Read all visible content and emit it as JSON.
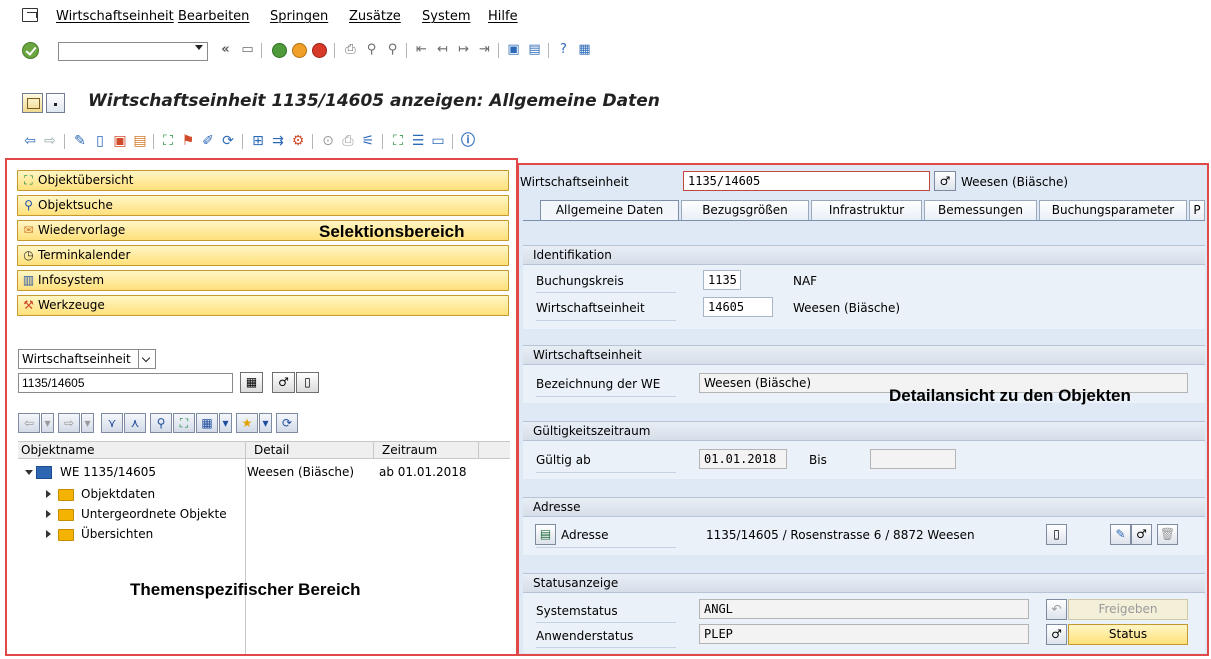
{
  "menu": {
    "items": [
      "Wirtschaftseinheit",
      "Bearbeiten",
      "Springen",
      "Zusätze",
      "System",
      "Hilfe"
    ]
  },
  "standard_toolbar": {
    "command_field_value": "",
    "back_glyph": "«"
  },
  "title": "Wirtschaftseinheit 1135/14605 anzeigen: Allgemeine Daten",
  "left_panel": {
    "nav_buttons": [
      {
        "label": "Objektübersicht",
        "icon": "hierarchy-icon"
      },
      {
        "label": "Objektsuche",
        "icon": "binoculars-icon"
      },
      {
        "label": "Wiedervorlage",
        "icon": "resubmission-icon"
      },
      {
        "label": "Terminkalender",
        "icon": "clock-icon"
      },
      {
        "label": "Infosystem",
        "icon": "infosystem-icon"
      },
      {
        "label": "Werkzeuge",
        "icon": "tools-icon"
      }
    ],
    "selection_area_label": "Selektionsbereich",
    "object_type": "Wirtschaftseinheit",
    "object_input": "1135/14605",
    "tree": {
      "columns": [
        "Objektname",
        "Detail",
        "Zeitraum"
      ],
      "root": {
        "name": "WE 1135/14605",
        "detail": "Weesen (Biäsche)",
        "period": "ab 01.01.2018"
      },
      "children": [
        "Objektdaten",
        "Untergeordnete Objekte",
        "Übersichten"
      ]
    },
    "theme_area_label": "Themenspezifischer Bereich"
  },
  "right_panel": {
    "header": {
      "label": "Wirtschaftseinheit",
      "value": "1135/14605",
      "description": "Weesen (Biäsche)"
    },
    "tabs": [
      "Allgemeine Daten",
      "Bezugsgrößen",
      "Infrastruktur",
      "Bemessungen",
      "Buchungsparameter",
      "P"
    ],
    "groups": {
      "identifikation": {
        "title": "Identifikation",
        "buchungskreis_label": "Buchungskreis",
        "buchungskreis_value": "1135",
        "buchungskreis_text": "NAF",
        "we_label": "Wirtschaftseinheit",
        "we_value": "14605",
        "we_text": "Weesen (Biäsche)"
      },
      "wirtschaftseinheit": {
        "title": "Wirtschaftseinheit",
        "bez_label": "Bezeichnung der WE",
        "bez_value": "Weesen (Biäsche)"
      },
      "gueltigkeit": {
        "title": "Gültigkeitszeitraum",
        "ab_label": "Gültig ab",
        "ab_value": "01.01.2018",
        "bis_label": "Bis",
        "bis_value": ""
      },
      "adresse": {
        "title": "Adresse",
        "button_label": "Adresse",
        "value": "1135/14605 / Rosenstrasse 6 / 8872 Weesen"
      },
      "status": {
        "title": "Statusanzeige",
        "system_label": "Systemstatus",
        "system_value": "ANGL",
        "user_label": "Anwenderstatus",
        "user_value": "PLEP",
        "release_button": "Freigeben",
        "status_button": "Status"
      }
    },
    "detail_area_label": "Detailansicht zu den Objekten"
  }
}
